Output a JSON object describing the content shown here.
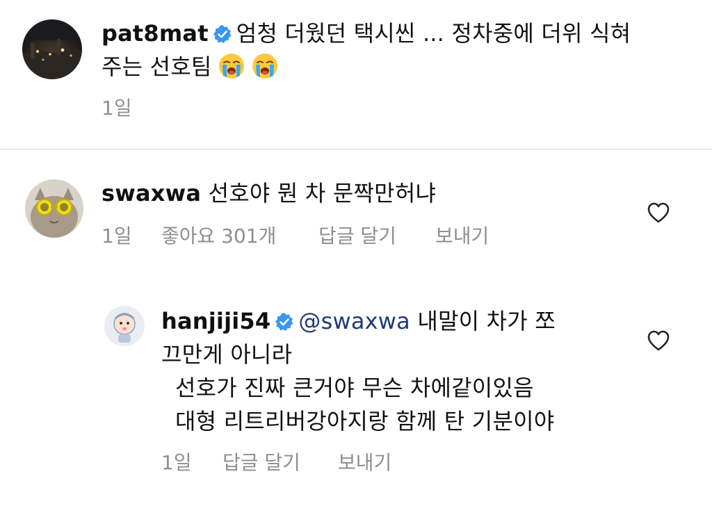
{
  "comments": [
    {
      "username": "pat8mat",
      "verified": true,
      "text_line1": "엄청 더웠던 택시씬 ... 정차중에 더위 식혀",
      "text_line2": "주는 선호팀",
      "emojis": [
        "loudly-crying-face",
        "loudly-crying-face"
      ],
      "time": "1일"
    },
    {
      "username": "swaxwa",
      "verified": false,
      "text": "선호야 뭔 차 문짝만허냐",
      "time": "1일",
      "likes": "좋아요 301개",
      "reply_label": "답글 달기",
      "send_label": "보내기"
    },
    {
      "username": "hanjiji54",
      "verified": true,
      "mention": "@swaxwa",
      "text_line1": "내말이 차가 쪼",
      "text_line2": "끄만게  아니라",
      "text_line3": "선호가 진짜 큰거야 무슨 차에같이있음",
      "text_line4": "대형 리트리버강아지랑 함께 탄 기분이야",
      "time": "1일",
      "reply_label": "답글 달기",
      "send_label": "보내기"
    }
  ],
  "colors": {
    "text": "#111111",
    "meta": "#8e8e8e",
    "verified": "#3897f0",
    "mention": "#1f3a75",
    "divider": "#e6e6e6"
  }
}
